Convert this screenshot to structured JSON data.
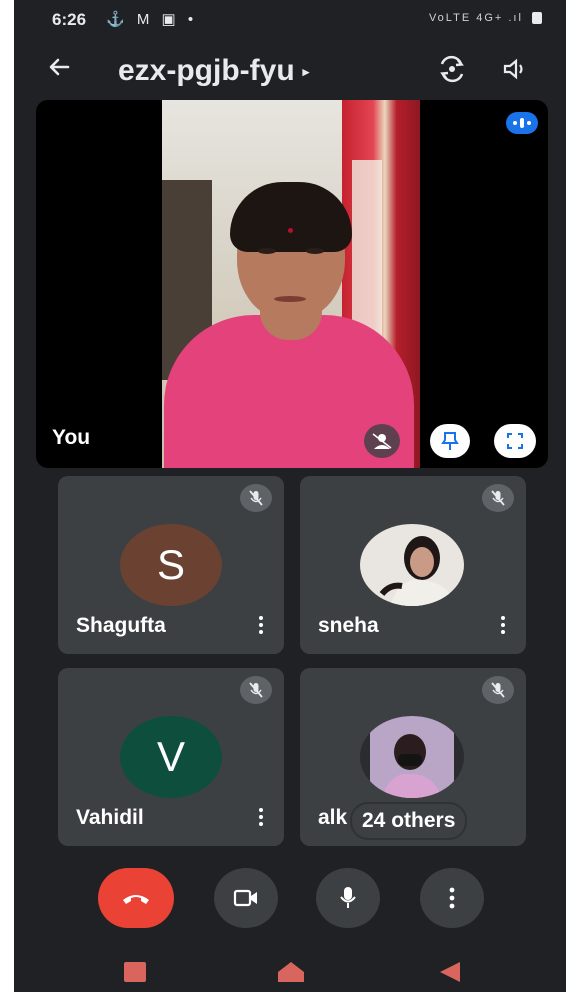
{
  "status_bar": {
    "time": "6:26",
    "left_icons": "⚓ M ▣ •",
    "right_text": "VoLTE 4G+ .ıl"
  },
  "app_bar": {
    "meeting_code": "ezx-pgjb-fyu",
    "caret": "▸"
  },
  "self_view": {
    "label": "You"
  },
  "participants": [
    {
      "name": "Shagufta",
      "initial": "S",
      "avatar_color": "#6b4232",
      "muted": true
    },
    {
      "name": "sneha",
      "initial": "",
      "photo": true,
      "muted": true
    },
    {
      "name": "Vahidil",
      "initial": "V",
      "avatar_color": "#0d4f3c",
      "muted": true
    },
    {
      "name": "alk",
      "initial": "",
      "photo": true,
      "muted": true
    }
  ],
  "others": {
    "label": "24 others"
  },
  "colors": {
    "hangup": "#ea4335",
    "accent": "#1a73e8",
    "background": "#202124",
    "tile": "#3c4043"
  },
  "icons": {
    "back": "arrow-left-icon",
    "switch_camera": "switch-camera-icon",
    "speaker": "speaker-icon",
    "pin": "pin-icon",
    "fullscreen": "fullscreen-icon",
    "effects": "effects-icon",
    "mic_off": "mic-off-icon",
    "hangup": "phone-hangup-icon",
    "camera": "video-camera-icon",
    "mic": "microphone-icon",
    "more": "more-vert-icon"
  }
}
